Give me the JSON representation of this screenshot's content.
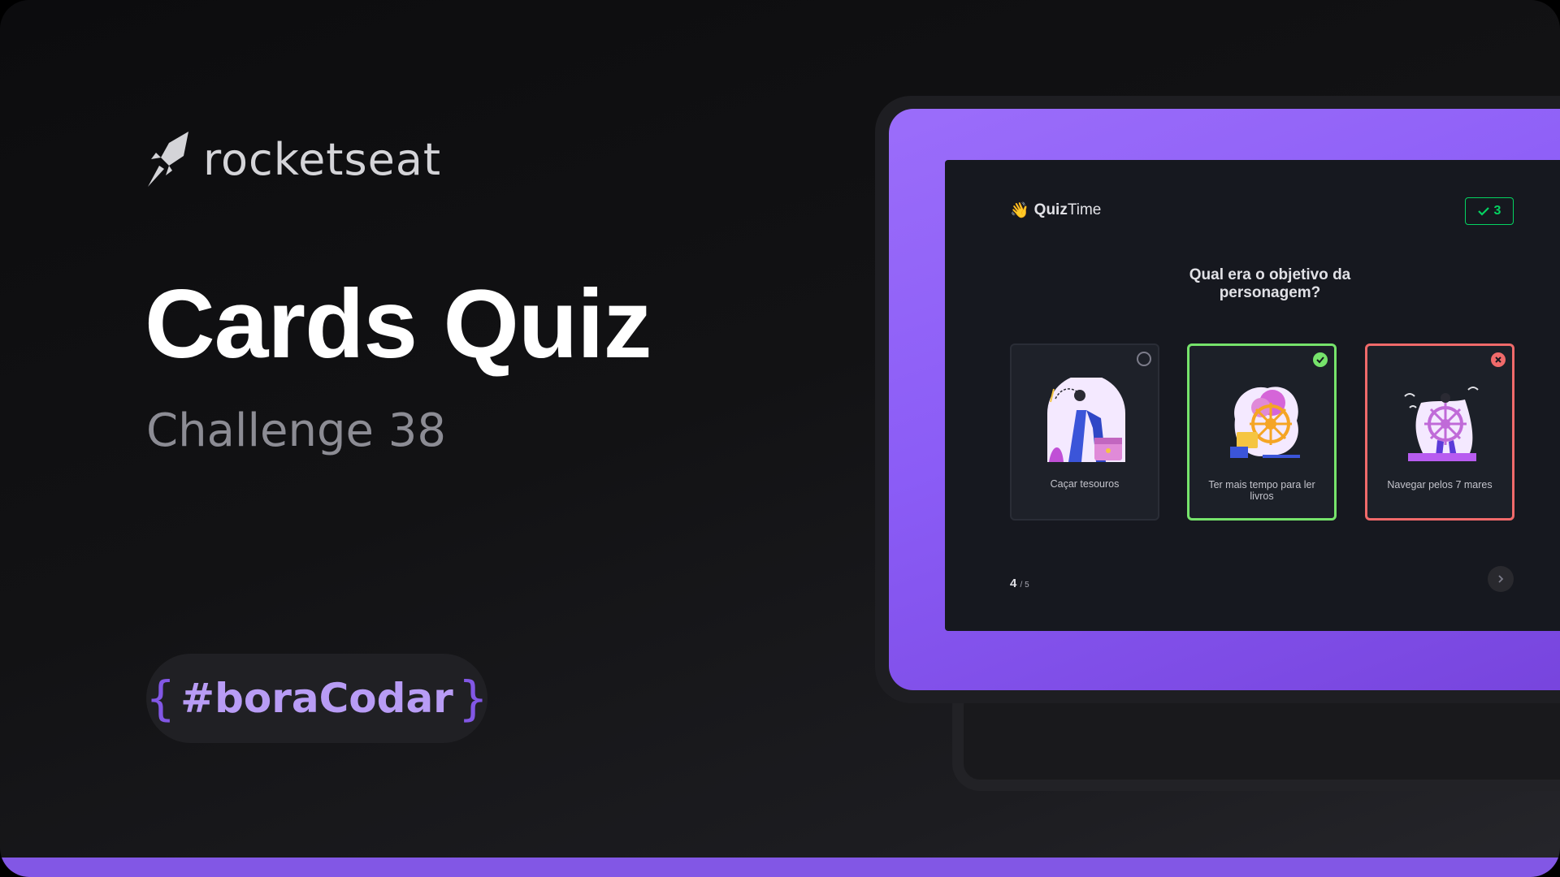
{
  "brand": {
    "name": "rocketseat",
    "icon": "rocket-icon"
  },
  "hero": {
    "title": "Cards Quiz",
    "subtitle": "Challenge 38"
  },
  "tag": {
    "open": "{",
    "text": "#boraCodar",
    "close": "}"
  },
  "colors": {
    "accent": "#8257e5",
    "correct": "#04d361",
    "wrong": "#f06a6a",
    "background": "#121214"
  },
  "mockup": {
    "app": {
      "emoji": "👋",
      "name_bold": "Quiz",
      "name_rest": "Time"
    },
    "score": {
      "icon": "check-icon",
      "value": "3"
    },
    "question": "Qual era o objetivo da personagem?",
    "options": [
      {
        "label": "Caçar tesouros",
        "state": "unselected",
        "icon": "circle-icon"
      },
      {
        "label": "Ter mais tempo para ler livros",
        "state": "correct",
        "icon": "check-circle-icon"
      },
      {
        "label": "Navegar pelos 7 mares",
        "state": "wrong",
        "icon": "x-circle-icon"
      }
    ],
    "progress": {
      "current": "4",
      "total": "/ 5"
    },
    "next": {
      "icon": "chevron-right-icon"
    }
  }
}
